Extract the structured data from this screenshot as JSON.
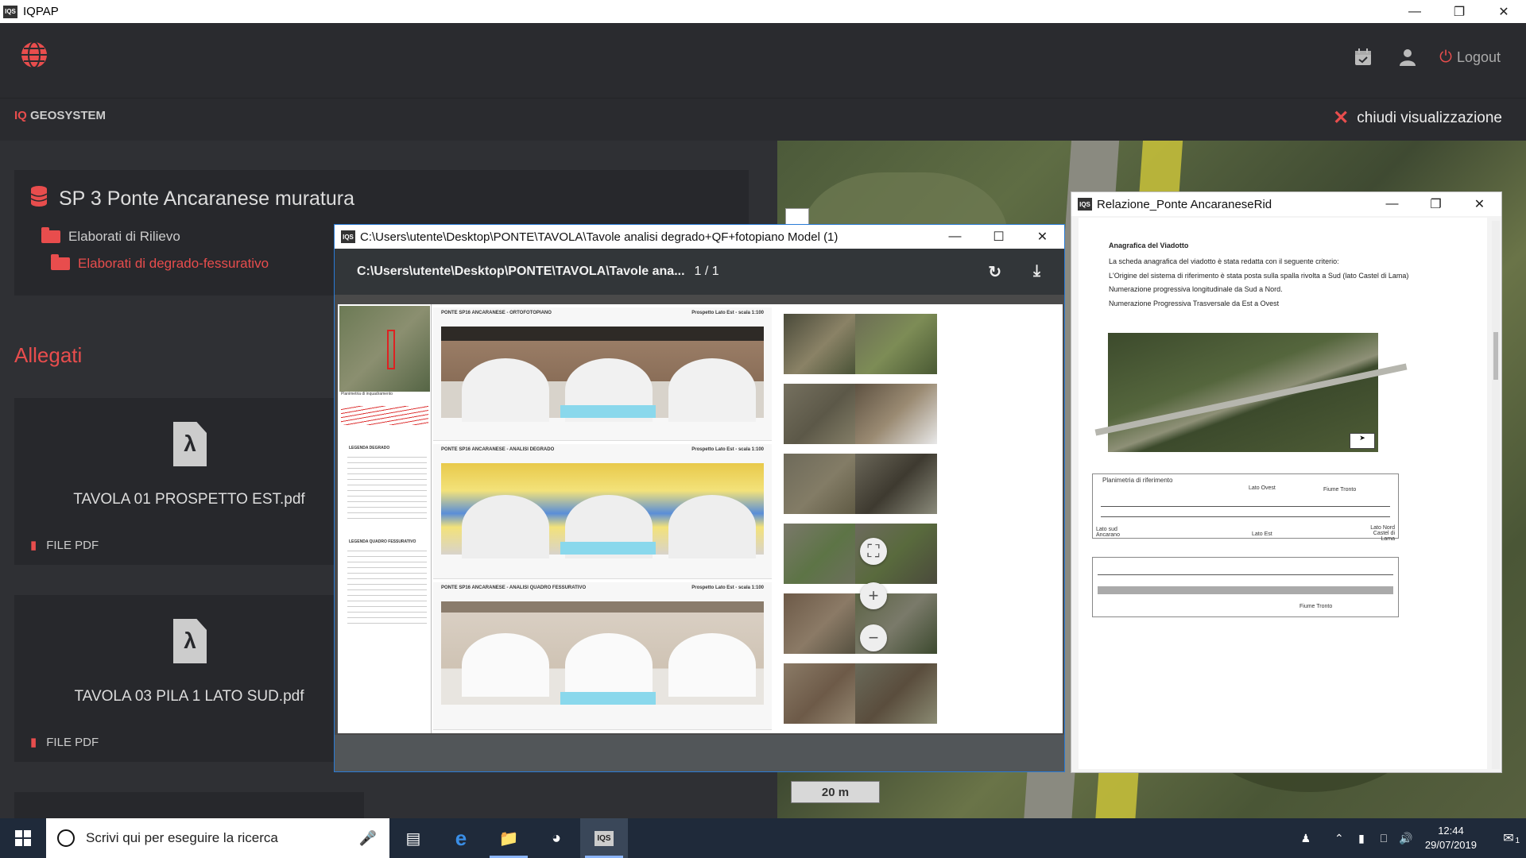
{
  "os_window": {
    "title": "IQPAP",
    "app_icon": "IQS"
  },
  "header": {
    "icons": [
      "calendar-check-icon",
      "user-icon"
    ],
    "logout_label": "Logout"
  },
  "subbar": {
    "brand_prefix": "IQ",
    "brand_name": "GEOSYSTEM",
    "close_view_label": "chiudi visualizzazione"
  },
  "project": {
    "title": "SP 3 Ponte Ancaranese muratura",
    "folders": [
      {
        "label": "Elaborati di Rilievo",
        "active": false
      },
      {
        "label": "Elaborati di degrado-fessurativo",
        "active": true
      }
    ]
  },
  "attachments": {
    "heading": "Allegati",
    "files": [
      {
        "name": "TAVOLA 01 PROSPETTO EST.pdf",
        "type": "FILE PDF"
      },
      {
        "name": "TAVOLA 03 PILA 1 LATO SUD.pdf",
        "type": "FILE PDF"
      }
    ]
  },
  "map": {
    "scale_label": "20 m"
  },
  "pdf_viewer": {
    "window_title": "C:\\Users\\utente\\Desktop\\PONTE\\TAVOLA\\Tavole analisi degrado+QF+fotopiano Model (1)",
    "toolbar_title": "C:\\Users\\utente\\Desktop\\PONTE\\TAVOLA\\Tavole ana...",
    "page_indicator": "1  /  1",
    "sheet": {
      "strip_titles": [
        "PONTE SP16 ANCARANESE - ORTOFOTOPIANO",
        "PONTE SP16 ANCARANESE - ANALISI DEGRADO",
        "PONTE SP16 ANCARANESE - ANALISI QUADRO FESSURATIVO"
      ],
      "strip_subtitles": [
        "Prospetto Lato Est - scala 1:100",
        "Prospetto Lato Est - scala 1:100",
        "Prospetto Lato Est - scala 1:100"
      ],
      "legend_degrado": "LEGENDA DEGRADO",
      "legend_fessurativo": "LEGENDA QUADRO FESSURATIVO",
      "planimetria_label": "Planimetria di inquadramento"
    }
  },
  "relazione": {
    "window_title": "Relazione_Ponte AncaraneseRid",
    "heading": "Anagrafica del Viadotto",
    "lines": [
      "La scheda anagrafica del viadotto è stata redatta con  il seguente criterio:",
      " L'Origine del sistema di riferimento è stata posta sulla spalla rivolta a Sud (lato Castel di Lama)",
      "Numerazione progressiva longitudinale da  Sud a Nord.",
      "Numerazione Progressiva Trasversale da Est a Ovest"
    ],
    "plan_title": "Planimetria di riferimento",
    "plan_labels": {
      "lato_ovest": "Lato Ovest",
      "lato_est": "Lato Est",
      "fiume": "Fiume Tronto",
      "lato_sud": "Lato sud Ancarano",
      "lato_nord": "Lato Nord Castel di Lama"
    }
  },
  "taskbar": {
    "search_placeholder": "Scrivi qui per eseguire la ricerca",
    "time": "12:44",
    "date": "29/07/2019",
    "notification_count": "1"
  }
}
